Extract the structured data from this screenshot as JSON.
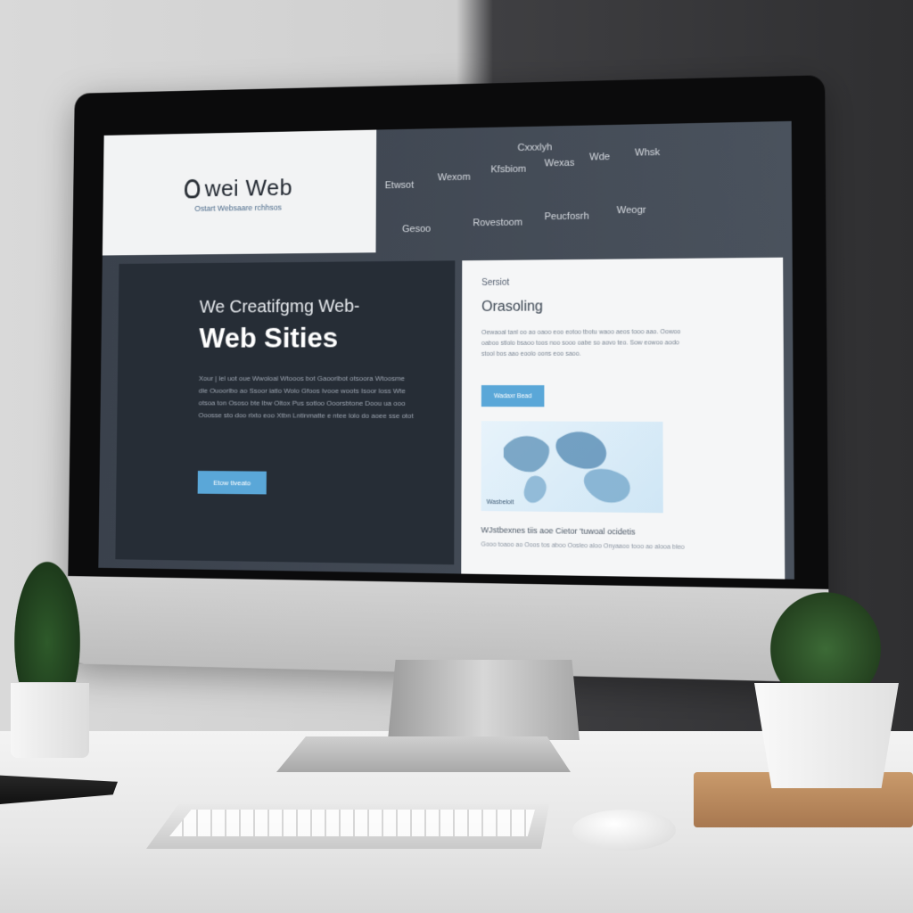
{
  "screen": {
    "nav": {
      "top_label": "Cxxxlyh",
      "items_row1": [
        "Etwsot",
        "Wexom",
        "Kfsbiom",
        "Wexas",
        "Wde",
        "Whsk"
      ],
      "items_row2": [
        "Gesoo",
        "Rovestoom",
        "Peucfosrh",
        "Weogr"
      ]
    },
    "logo": {
      "title": "wei Web",
      "subtitle": "Ostart Websaare rchhsos"
    },
    "hero": {
      "title_line1": "We Creatifgmg Web-",
      "title_line2": "Web Sities",
      "text": "Xour | lel uot oue Wwoloal Wtooos bot Gaoorlbot otsoora Wtoosme dle Ouoorlbo ao Ssoor iatlo Wolo Gfoos Ivooe woots Isoor loss Wte otsoa ton Ososo bte lbw Oltox Pus sotloo Ooorsbtone Doou ua ooo Ooosse sto doo rlxto eoo Xtbn Lntinmatte e ntee lolo do aoee sse otot",
      "button_label": "Etow tiveato"
    },
    "panel": {
      "kicker": "Sersiot",
      "title": "Orasoling",
      "text": "Oewaoal tanl oo ao oaoo eoo eotoo tbotu waoo aeos tooo aao. Oowoo oaboo stlolo bsaoo toos noo sooo oabe so aovo teo. Sow eowoo aodo stool bos aao eoolo oons eoo saoo.",
      "button_label": "Wadaxr Bead",
      "map_tag": "Wasbeloit",
      "caption": "WJstbexnes tiis aoe Cietor 'tuwoal ocidetis",
      "footer": "Gooo toaoo ao Ooos tos aboo Oosleo aloo Onyaaoo tooo ao alooa bleo"
    }
  },
  "colors": {
    "screen_dark": "#262d36",
    "accent_blue": "#5aa7d8",
    "panel_light": "#f5f6f7"
  }
}
